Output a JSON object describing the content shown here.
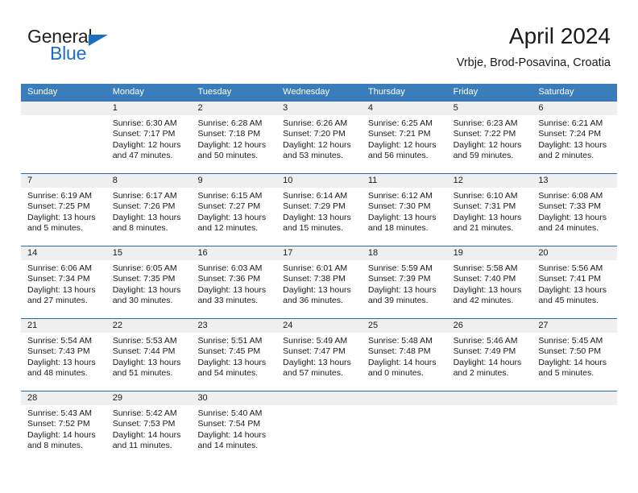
{
  "brand": {
    "word1": "General",
    "word2": "Blue",
    "accent_color": "#1b6ec2"
  },
  "header": {
    "month_title": "April 2024",
    "location": "Vrbje, Brod-Posavina, Croatia"
  },
  "calendar": {
    "header_bg": "#3b7cbb",
    "num_band_bg": "#efefef",
    "separator_color": "#2b6aa8",
    "weekdays": [
      "Sunday",
      "Monday",
      "Tuesday",
      "Wednesday",
      "Thursday",
      "Friday",
      "Saturday"
    ],
    "weeks": [
      [
        {
          "day": "",
          "sunrise": "",
          "sunset": "",
          "daylight1": "",
          "daylight2": ""
        },
        {
          "day": "1",
          "sunrise": "Sunrise: 6:30 AM",
          "sunset": "Sunset: 7:17 PM",
          "daylight1": "Daylight: 12 hours",
          "daylight2": "and 47 minutes."
        },
        {
          "day": "2",
          "sunrise": "Sunrise: 6:28 AM",
          "sunset": "Sunset: 7:18 PM",
          "daylight1": "Daylight: 12 hours",
          "daylight2": "and 50 minutes."
        },
        {
          "day": "3",
          "sunrise": "Sunrise: 6:26 AM",
          "sunset": "Sunset: 7:20 PM",
          "daylight1": "Daylight: 12 hours",
          "daylight2": "and 53 minutes."
        },
        {
          "day": "4",
          "sunrise": "Sunrise: 6:25 AM",
          "sunset": "Sunset: 7:21 PM",
          "daylight1": "Daylight: 12 hours",
          "daylight2": "and 56 minutes."
        },
        {
          "day": "5",
          "sunrise": "Sunrise: 6:23 AM",
          "sunset": "Sunset: 7:22 PM",
          "daylight1": "Daylight: 12 hours",
          "daylight2": "and 59 minutes."
        },
        {
          "day": "6",
          "sunrise": "Sunrise: 6:21 AM",
          "sunset": "Sunset: 7:24 PM",
          "daylight1": "Daylight: 13 hours",
          "daylight2": "and 2 minutes."
        }
      ],
      [
        {
          "day": "7",
          "sunrise": "Sunrise: 6:19 AM",
          "sunset": "Sunset: 7:25 PM",
          "daylight1": "Daylight: 13 hours",
          "daylight2": "and 5 minutes."
        },
        {
          "day": "8",
          "sunrise": "Sunrise: 6:17 AM",
          "sunset": "Sunset: 7:26 PM",
          "daylight1": "Daylight: 13 hours",
          "daylight2": "and 8 minutes."
        },
        {
          "day": "9",
          "sunrise": "Sunrise: 6:15 AM",
          "sunset": "Sunset: 7:27 PM",
          "daylight1": "Daylight: 13 hours",
          "daylight2": "and 12 minutes."
        },
        {
          "day": "10",
          "sunrise": "Sunrise: 6:14 AM",
          "sunset": "Sunset: 7:29 PM",
          "daylight1": "Daylight: 13 hours",
          "daylight2": "and 15 minutes."
        },
        {
          "day": "11",
          "sunrise": "Sunrise: 6:12 AM",
          "sunset": "Sunset: 7:30 PM",
          "daylight1": "Daylight: 13 hours",
          "daylight2": "and 18 minutes."
        },
        {
          "day": "12",
          "sunrise": "Sunrise: 6:10 AM",
          "sunset": "Sunset: 7:31 PM",
          "daylight1": "Daylight: 13 hours",
          "daylight2": "and 21 minutes."
        },
        {
          "day": "13",
          "sunrise": "Sunrise: 6:08 AM",
          "sunset": "Sunset: 7:33 PM",
          "daylight1": "Daylight: 13 hours",
          "daylight2": "and 24 minutes."
        }
      ],
      [
        {
          "day": "14",
          "sunrise": "Sunrise: 6:06 AM",
          "sunset": "Sunset: 7:34 PM",
          "daylight1": "Daylight: 13 hours",
          "daylight2": "and 27 minutes."
        },
        {
          "day": "15",
          "sunrise": "Sunrise: 6:05 AM",
          "sunset": "Sunset: 7:35 PM",
          "daylight1": "Daylight: 13 hours",
          "daylight2": "and 30 minutes."
        },
        {
          "day": "16",
          "sunrise": "Sunrise: 6:03 AM",
          "sunset": "Sunset: 7:36 PM",
          "daylight1": "Daylight: 13 hours",
          "daylight2": "and 33 minutes."
        },
        {
          "day": "17",
          "sunrise": "Sunrise: 6:01 AM",
          "sunset": "Sunset: 7:38 PM",
          "daylight1": "Daylight: 13 hours",
          "daylight2": "and 36 minutes."
        },
        {
          "day": "18",
          "sunrise": "Sunrise: 5:59 AM",
          "sunset": "Sunset: 7:39 PM",
          "daylight1": "Daylight: 13 hours",
          "daylight2": "and 39 minutes."
        },
        {
          "day": "19",
          "sunrise": "Sunrise: 5:58 AM",
          "sunset": "Sunset: 7:40 PM",
          "daylight1": "Daylight: 13 hours",
          "daylight2": "and 42 minutes."
        },
        {
          "day": "20",
          "sunrise": "Sunrise: 5:56 AM",
          "sunset": "Sunset: 7:41 PM",
          "daylight1": "Daylight: 13 hours",
          "daylight2": "and 45 minutes."
        }
      ],
      [
        {
          "day": "21",
          "sunrise": "Sunrise: 5:54 AM",
          "sunset": "Sunset: 7:43 PM",
          "daylight1": "Daylight: 13 hours",
          "daylight2": "and 48 minutes."
        },
        {
          "day": "22",
          "sunrise": "Sunrise: 5:53 AM",
          "sunset": "Sunset: 7:44 PM",
          "daylight1": "Daylight: 13 hours",
          "daylight2": "and 51 minutes."
        },
        {
          "day": "23",
          "sunrise": "Sunrise: 5:51 AM",
          "sunset": "Sunset: 7:45 PM",
          "daylight1": "Daylight: 13 hours",
          "daylight2": "and 54 minutes."
        },
        {
          "day": "24",
          "sunrise": "Sunrise: 5:49 AM",
          "sunset": "Sunset: 7:47 PM",
          "daylight1": "Daylight: 13 hours",
          "daylight2": "and 57 minutes."
        },
        {
          "day": "25",
          "sunrise": "Sunrise: 5:48 AM",
          "sunset": "Sunset: 7:48 PM",
          "daylight1": "Daylight: 14 hours",
          "daylight2": "and 0 minutes."
        },
        {
          "day": "26",
          "sunrise": "Sunrise: 5:46 AM",
          "sunset": "Sunset: 7:49 PM",
          "daylight1": "Daylight: 14 hours",
          "daylight2": "and 2 minutes."
        },
        {
          "day": "27",
          "sunrise": "Sunrise: 5:45 AM",
          "sunset": "Sunset: 7:50 PM",
          "daylight1": "Daylight: 14 hours",
          "daylight2": "and 5 minutes."
        }
      ],
      [
        {
          "day": "28",
          "sunrise": "Sunrise: 5:43 AM",
          "sunset": "Sunset: 7:52 PM",
          "daylight1": "Daylight: 14 hours",
          "daylight2": "and 8 minutes."
        },
        {
          "day": "29",
          "sunrise": "Sunrise: 5:42 AM",
          "sunset": "Sunset: 7:53 PM",
          "daylight1": "Daylight: 14 hours",
          "daylight2": "and 11 minutes."
        },
        {
          "day": "30",
          "sunrise": "Sunrise: 5:40 AM",
          "sunset": "Sunset: 7:54 PM",
          "daylight1": "Daylight: 14 hours",
          "daylight2": "and 14 minutes."
        },
        {
          "day": "",
          "sunrise": "",
          "sunset": "",
          "daylight1": "",
          "daylight2": ""
        },
        {
          "day": "",
          "sunrise": "",
          "sunset": "",
          "daylight1": "",
          "daylight2": ""
        },
        {
          "day": "",
          "sunrise": "",
          "sunset": "",
          "daylight1": "",
          "daylight2": ""
        },
        {
          "day": "",
          "sunrise": "",
          "sunset": "",
          "daylight1": "",
          "daylight2": ""
        }
      ]
    ]
  }
}
